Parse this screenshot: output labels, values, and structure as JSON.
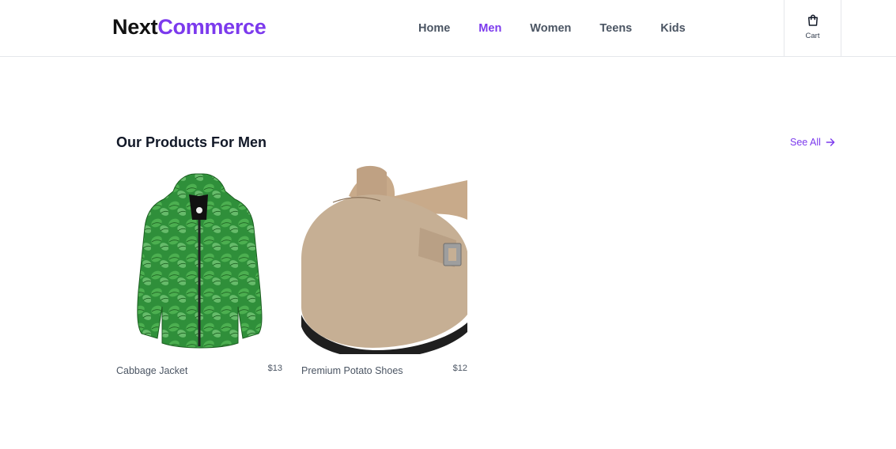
{
  "brand": {
    "part1": "Next",
    "part2": "Commerce"
  },
  "nav": {
    "home": "Home",
    "men": "Men",
    "women": "Women",
    "teens": "Teens",
    "kids": "Kids",
    "active": "Men"
  },
  "cart": {
    "label": "Cart",
    "icon": "shopping-bag-icon"
  },
  "section": {
    "title": "Our Products For Men",
    "see_all": "See All",
    "see_all_icon": "arrow-right-icon"
  },
  "products": [
    {
      "name": "Cabbage Jacket",
      "price": "$13"
    },
    {
      "name": "Premium Potato Shoes",
      "price": "$12"
    }
  ],
  "colors": {
    "accent": "#7c3aed",
    "text": "#111827",
    "muted": "#4b5563",
    "border": "#e5e7eb"
  }
}
